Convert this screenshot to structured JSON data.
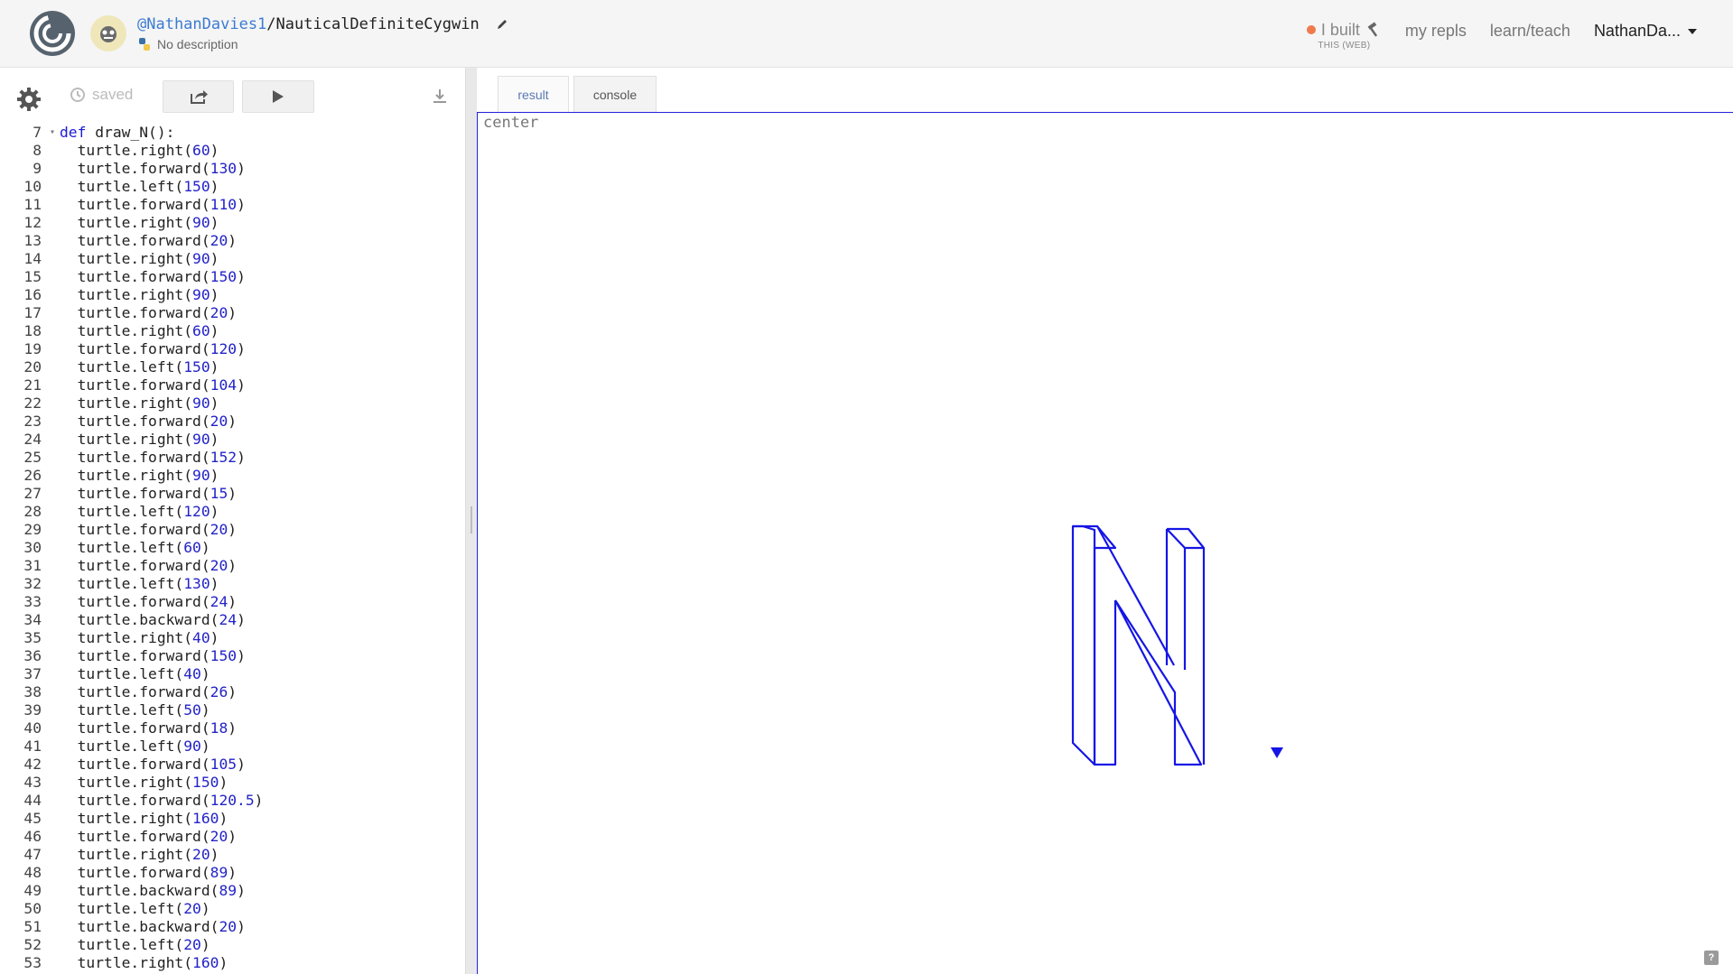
{
  "header": {
    "owner": "@NathanDavies1",
    "separator": "/",
    "repl_name": "NauticalDefiniteCygwin",
    "description": "No description",
    "nav": {
      "ibuilt_label": "I built",
      "ibuilt_sub": "THIS (WEB)",
      "my_repls": "my repls",
      "learn_teach": "learn/teach",
      "user": "NathanDa..."
    }
  },
  "toolbar": {
    "saved_label": "saved"
  },
  "editor": {
    "lines": [
      {
        "n": "7",
        "fold": true,
        "parts": [
          [
            "kw",
            "def"
          ],
          [
            "src",
            " draw_N():"
          ]
        ]
      },
      {
        "n": "8",
        "parts": [
          [
            "src",
            "  turtle.right("
          ],
          [
            "num",
            "60"
          ],
          [
            "src",
            ")"
          ]
        ]
      },
      {
        "n": "9",
        "parts": [
          [
            "src",
            "  turtle.forward("
          ],
          [
            "num",
            "130"
          ],
          [
            "src",
            ")"
          ]
        ]
      },
      {
        "n": "10",
        "parts": [
          [
            "src",
            "  turtle.left("
          ],
          [
            "num",
            "150"
          ],
          [
            "src",
            ")"
          ]
        ]
      },
      {
        "n": "11",
        "parts": [
          [
            "src",
            "  turtle.forward("
          ],
          [
            "num",
            "110"
          ],
          [
            "src",
            ")"
          ]
        ]
      },
      {
        "n": "12",
        "parts": [
          [
            "src",
            "  turtle.right("
          ],
          [
            "num",
            "90"
          ],
          [
            "src",
            ")"
          ]
        ]
      },
      {
        "n": "13",
        "parts": [
          [
            "src",
            "  turtle.forward("
          ],
          [
            "num",
            "20"
          ],
          [
            "src",
            ")"
          ]
        ]
      },
      {
        "n": "14",
        "parts": [
          [
            "src",
            "  turtle.right("
          ],
          [
            "num",
            "90"
          ],
          [
            "src",
            ")"
          ]
        ]
      },
      {
        "n": "15",
        "parts": [
          [
            "src",
            "  turtle.forward("
          ],
          [
            "num",
            "150"
          ],
          [
            "src",
            ")"
          ]
        ]
      },
      {
        "n": "16",
        "parts": [
          [
            "src",
            "  turtle.right("
          ],
          [
            "num",
            "90"
          ],
          [
            "src",
            ")"
          ]
        ]
      },
      {
        "n": "17",
        "parts": [
          [
            "src",
            "  turtle.forward("
          ],
          [
            "num",
            "20"
          ],
          [
            "src",
            ")"
          ]
        ]
      },
      {
        "n": "18",
        "parts": [
          [
            "src",
            "  turtle.right("
          ],
          [
            "num",
            "60"
          ],
          [
            "src",
            ")"
          ]
        ]
      },
      {
        "n": "19",
        "parts": [
          [
            "src",
            "  turtle.forward("
          ],
          [
            "num",
            "120"
          ],
          [
            "src",
            ")"
          ]
        ]
      },
      {
        "n": "20",
        "parts": [
          [
            "src",
            "  turtle.left("
          ],
          [
            "num",
            "150"
          ],
          [
            "src",
            ")"
          ]
        ]
      },
      {
        "n": "21",
        "parts": [
          [
            "src",
            "  turtle.forward("
          ],
          [
            "num",
            "104"
          ],
          [
            "src",
            ")"
          ]
        ]
      },
      {
        "n": "22",
        "parts": [
          [
            "src",
            "  turtle.right("
          ],
          [
            "num",
            "90"
          ],
          [
            "src",
            ")"
          ]
        ]
      },
      {
        "n": "23",
        "parts": [
          [
            "src",
            "  turtle.forward("
          ],
          [
            "num",
            "20"
          ],
          [
            "src",
            ")"
          ]
        ]
      },
      {
        "n": "24",
        "parts": [
          [
            "src",
            "  turtle.right("
          ],
          [
            "num",
            "90"
          ],
          [
            "src",
            ")"
          ]
        ]
      },
      {
        "n": "25",
        "parts": [
          [
            "src",
            "  turtle.forward("
          ],
          [
            "num",
            "152"
          ],
          [
            "src",
            ")"
          ]
        ]
      },
      {
        "n": "26",
        "parts": [
          [
            "src",
            "  turtle.right("
          ],
          [
            "num",
            "90"
          ],
          [
            "src",
            ")"
          ]
        ]
      },
      {
        "n": "27",
        "parts": [
          [
            "src",
            "  turtle.forward("
          ],
          [
            "num",
            "15"
          ],
          [
            "src",
            ")"
          ]
        ]
      },
      {
        "n": "28",
        "parts": [
          [
            "src",
            "  turtle.left("
          ],
          [
            "num",
            "120"
          ],
          [
            "src",
            ")"
          ]
        ]
      },
      {
        "n": "29",
        "parts": [
          [
            "src",
            "  turtle.forward("
          ],
          [
            "num",
            "20"
          ],
          [
            "src",
            ")"
          ]
        ]
      },
      {
        "n": "30",
        "parts": [
          [
            "src",
            "  turtle.left("
          ],
          [
            "num",
            "60"
          ],
          [
            "src",
            ")"
          ]
        ]
      },
      {
        "n": "31",
        "parts": [
          [
            "src",
            "  turtle.forward("
          ],
          [
            "num",
            "20"
          ],
          [
            "src",
            ")"
          ]
        ]
      },
      {
        "n": "32",
        "parts": [
          [
            "src",
            "  turtle.left("
          ],
          [
            "num",
            "130"
          ],
          [
            "src",
            ")"
          ]
        ]
      },
      {
        "n": "33",
        "parts": [
          [
            "src",
            "  turtle.forward("
          ],
          [
            "num",
            "24"
          ],
          [
            "src",
            ")"
          ]
        ]
      },
      {
        "n": "34",
        "parts": [
          [
            "src",
            "  turtle.backward("
          ],
          [
            "num",
            "24"
          ],
          [
            "src",
            ")"
          ]
        ]
      },
      {
        "n": "35",
        "parts": [
          [
            "src",
            "  turtle.right("
          ],
          [
            "num",
            "40"
          ],
          [
            "src",
            ")"
          ]
        ]
      },
      {
        "n": "36",
        "parts": [
          [
            "src",
            "  turtle.forward("
          ],
          [
            "num",
            "150"
          ],
          [
            "src",
            ")"
          ]
        ]
      },
      {
        "n": "37",
        "parts": [
          [
            "src",
            "  turtle.left("
          ],
          [
            "num",
            "40"
          ],
          [
            "src",
            ")"
          ]
        ]
      },
      {
        "n": "38",
        "parts": [
          [
            "src",
            "  turtle.forward("
          ],
          [
            "num",
            "26"
          ],
          [
            "src",
            ")"
          ]
        ]
      },
      {
        "n": "39",
        "parts": [
          [
            "src",
            "  turtle.left("
          ],
          [
            "num",
            "50"
          ],
          [
            "src",
            ")"
          ]
        ]
      },
      {
        "n": "40",
        "parts": [
          [
            "src",
            "  turtle.forward("
          ],
          [
            "num",
            "18"
          ],
          [
            "src",
            ")"
          ]
        ]
      },
      {
        "n": "41",
        "parts": [
          [
            "src",
            "  turtle.left("
          ],
          [
            "num",
            "90"
          ],
          [
            "src",
            ")"
          ]
        ]
      },
      {
        "n": "42",
        "parts": [
          [
            "src",
            "  turtle.forward("
          ],
          [
            "num",
            "105"
          ],
          [
            "src",
            ")"
          ]
        ]
      },
      {
        "n": "43",
        "parts": [
          [
            "src",
            "  turtle.right("
          ],
          [
            "num",
            "150"
          ],
          [
            "src",
            ")"
          ]
        ]
      },
      {
        "n": "44",
        "parts": [
          [
            "src",
            "  turtle.forward("
          ],
          [
            "num",
            "120.5"
          ],
          [
            "src",
            ")"
          ]
        ]
      },
      {
        "n": "45",
        "parts": [
          [
            "src",
            "  turtle.right("
          ],
          [
            "num",
            "160"
          ],
          [
            "src",
            ")"
          ]
        ]
      },
      {
        "n": "46",
        "parts": [
          [
            "src",
            "  turtle.forward("
          ],
          [
            "num",
            "20"
          ],
          [
            "src",
            ")"
          ]
        ]
      },
      {
        "n": "47",
        "parts": [
          [
            "src",
            "  turtle.right("
          ],
          [
            "num",
            "20"
          ],
          [
            "src",
            ")"
          ]
        ]
      },
      {
        "n": "48",
        "parts": [
          [
            "src",
            "  turtle.forward("
          ],
          [
            "num",
            "89"
          ],
          [
            "src",
            ")"
          ]
        ]
      },
      {
        "n": "49",
        "parts": [
          [
            "src",
            "  turtle.backward("
          ],
          [
            "num",
            "89"
          ],
          [
            "src",
            ")"
          ]
        ]
      },
      {
        "n": "50",
        "parts": [
          [
            "src",
            "  turtle.left("
          ],
          [
            "num",
            "20"
          ],
          [
            "src",
            ")"
          ]
        ]
      },
      {
        "n": "51",
        "parts": [
          [
            "src",
            "  turtle.backward("
          ],
          [
            "num",
            "20"
          ],
          [
            "src",
            ")"
          ]
        ]
      },
      {
        "n": "52",
        "parts": [
          [
            "src",
            "  turtle.left("
          ],
          [
            "num",
            "20"
          ],
          [
            "src",
            ")"
          ]
        ]
      },
      {
        "n": "53",
        "parts": [
          [
            "src",
            "  turtle.right("
          ],
          [
            "num",
            "160"
          ],
          [
            "src",
            ")"
          ]
        ]
      }
    ]
  },
  "output": {
    "tabs": [
      "result",
      "console"
    ],
    "active_tab": "result",
    "canvas_text": "center",
    "help_label": "?",
    "drawing_color": "#1515e6"
  }
}
